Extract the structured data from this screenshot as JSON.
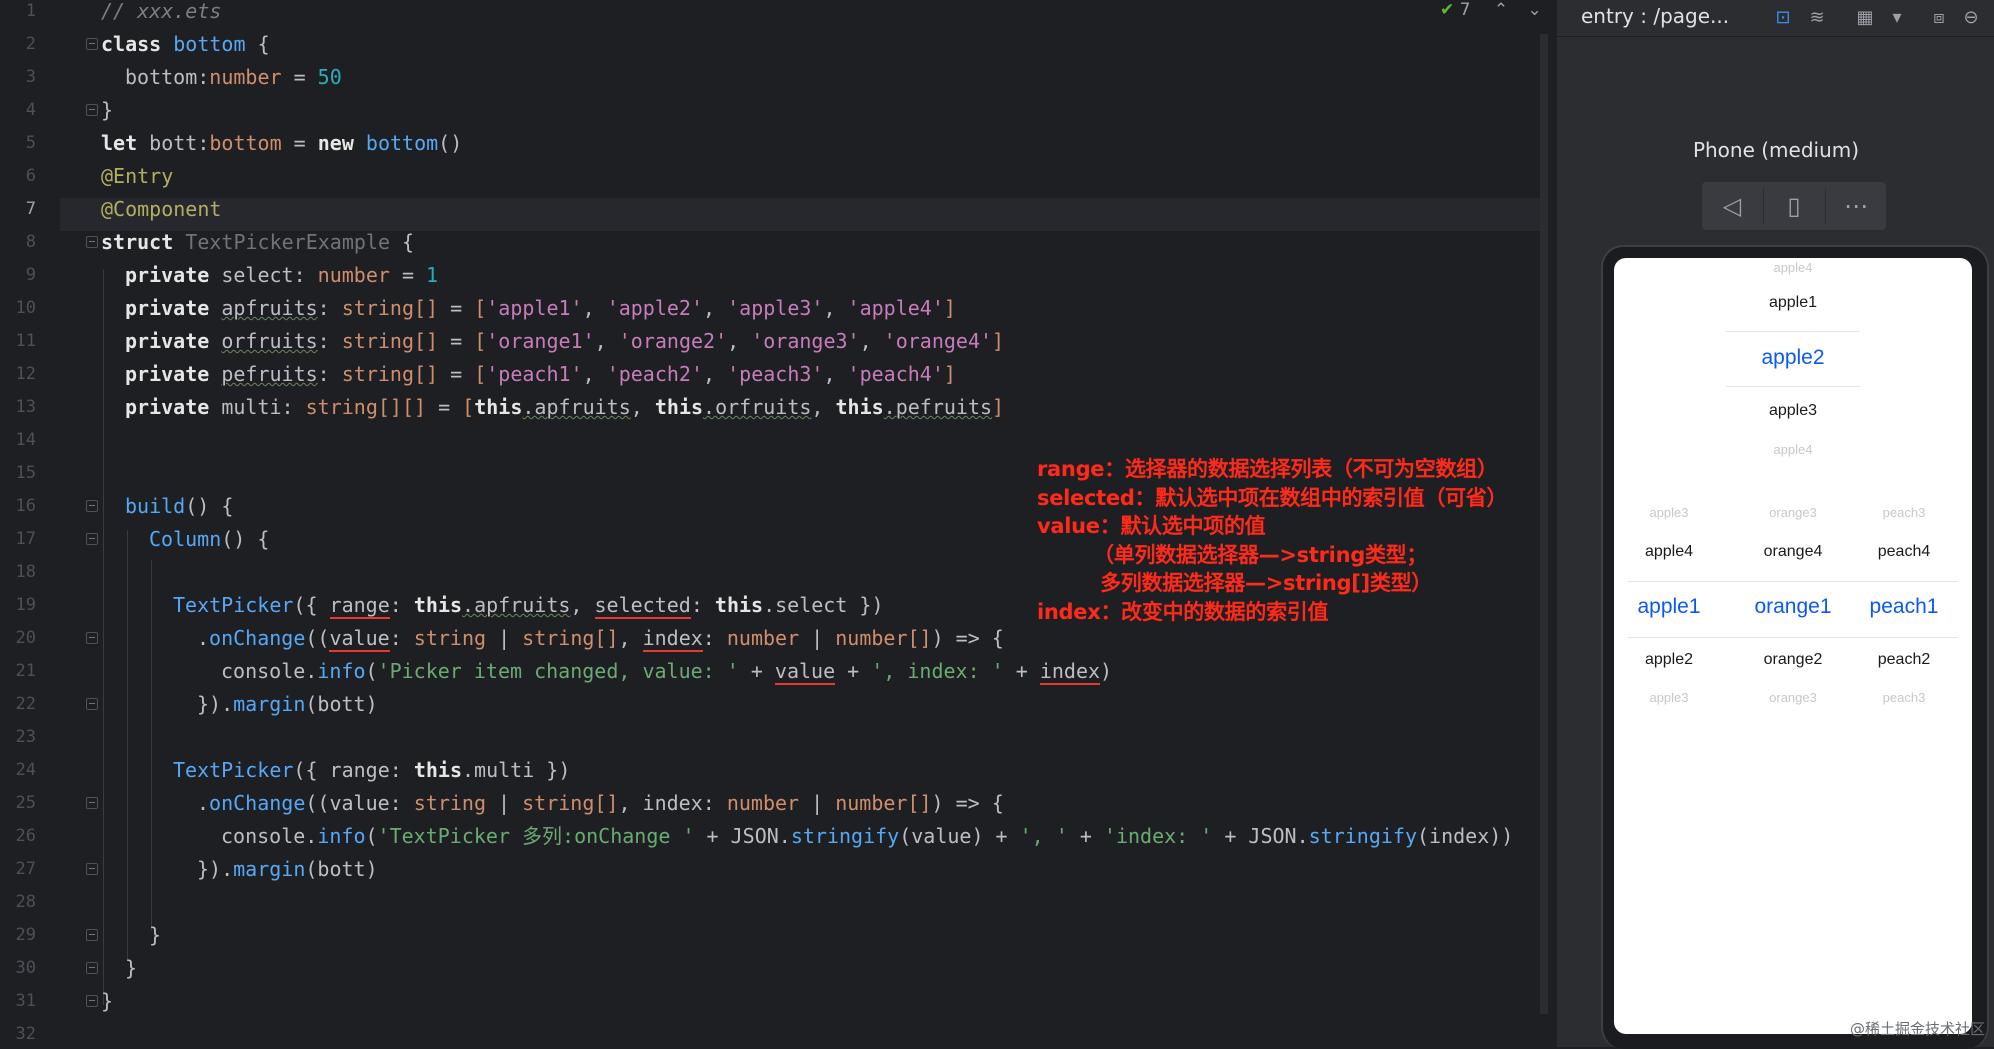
{
  "editor": {
    "inspection_count": "7",
    "lines": [
      {
        "n": "1"
      },
      {
        "n": "2"
      },
      {
        "n": "3"
      },
      {
        "n": "4"
      },
      {
        "n": "5"
      },
      {
        "n": "6"
      },
      {
        "n": "7"
      },
      {
        "n": "8"
      },
      {
        "n": "9"
      },
      {
        "n": "10"
      },
      {
        "n": "11"
      },
      {
        "n": "12"
      },
      {
        "n": "13"
      },
      {
        "n": "14"
      },
      {
        "n": "15"
      },
      {
        "n": "16"
      },
      {
        "n": "17"
      },
      {
        "n": "18"
      },
      {
        "n": "19"
      },
      {
        "n": "20"
      },
      {
        "n": "21"
      },
      {
        "n": "22"
      },
      {
        "n": "23"
      },
      {
        "n": "24"
      },
      {
        "n": "25"
      },
      {
        "n": "26"
      },
      {
        "n": "27"
      },
      {
        "n": "28"
      },
      {
        "n": "29"
      },
      {
        "n": "30"
      },
      {
        "n": "31"
      },
      {
        "n": "32"
      }
    ],
    "code": {
      "l1": "// xxx.ets",
      "l2a": "class",
      "l2b": "bottom",
      "l2c": "{",
      "l3a": "bottom:",
      "l3b": "number",
      "l3c": " = ",
      "l3d": "50",
      "l4": "}",
      "l5a": "let",
      "l5b": " bott:",
      "l5c": "bottom",
      "l5d": " = ",
      "l5e": "new",
      "l5f": "bottom",
      "l5g": "()",
      "l6": "@Entry",
      "l7": "@Component",
      "l8a": "struct",
      "l8b": "TextPickerExample",
      "l8c": "{",
      "l9a": "private",
      "l9b": " select: ",
      "l9c": "number",
      "l9d": " = ",
      "l9e": "1",
      "l10a": "private",
      "l10b": "apfruits",
      "l10c": ": ",
      "l10d": "string[]",
      "l10e": " = ",
      "l10f": "[",
      "l10g": "'apple1'",
      "l10h": "'apple2'",
      "l10i": "'apple3'",
      "l10j": "'apple4'",
      "l10k": "]",
      "l11a": "private",
      "l11b": "orfruits",
      "l11c": ": ",
      "l11d": "string[]",
      "l11e": " = ",
      "l11f": "[",
      "l11g": "'orange1'",
      "l11h": "'orange2'",
      "l11i": "'orange3'",
      "l11j": "'orange4'",
      "l11k": "]",
      "l12a": "private",
      "l12b": "pefruits",
      "l12c": ": ",
      "l12d": "string[]",
      "l12e": " = ",
      "l12f": "[",
      "l12g": "'peach1'",
      "l12h": "'peach2'",
      "l12i": "'peach3'",
      "l12j": "'peach4'",
      "l12k": "]",
      "l13a": "private",
      "l13b": " multi: ",
      "l13c": "string[][]",
      "l13d": " = ",
      "l13e": "[",
      "l13f": "this",
      "l13g": ".apfruits",
      "l13h": "this",
      "l13i": ".orfruits",
      "l13j": "this",
      "l13k": ".pefruits",
      "l13l": "]",
      "l16a": "build",
      "l16b": "() {",
      "l17a": "Column",
      "l17b": "() {",
      "l19a": "TextPicker",
      "l19b": "({ ",
      "l19c": "range",
      "l19d": ": ",
      "l19e": "this",
      "l19f": ".apfruits",
      "l19g": ", ",
      "l19h": "selected",
      "l19i": ": ",
      "l19j": "this",
      "l19k": ".select })",
      "l20a": ".",
      "l20b": "onChange",
      "l20c": "((",
      "l20d": "value",
      "l20e": ": ",
      "l20f": "string",
      "l20g": " | ",
      "l20h": "string[]",
      "l20i": ", ",
      "l20j": "index",
      "l20k": ": ",
      "l20l": "number",
      "l20m": " | ",
      "l20n": "number[]",
      "l20o": ") => {",
      "l21a": "console.",
      "l21b": "info",
      "l21c": "(",
      "l21d": "'Picker item changed, value: '",
      "l21e": " + ",
      "l21f": "value",
      "l21g": " + ",
      "l21h": "', index: '",
      "l21i": " + ",
      "l21j": "index",
      "l21k": ")",
      "l22a": "}).",
      "l22b": "margin",
      "l22c": "(bott)",
      "l24a": "TextPicker",
      "l24b": "({ range: ",
      "l24c": "this",
      "l24d": ".multi })",
      "l25a": ".",
      "l25b": "onChange",
      "l25c": "((value: ",
      "l25d": "string",
      "l25e": " | ",
      "l25f": "string[]",
      "l25g": ", index: ",
      "l25h": "number",
      "l25i": " | ",
      "l25j": "number[]",
      "l25k": ") => {",
      "l26a": "console.",
      "l26b": "info",
      "l26c": "(",
      "l26d": "'TextPicker 多列:onChange '",
      "l26e": " + JSON.",
      "l26f": "stringify",
      "l26g": "(value) + ",
      "l26h": "', '",
      "l26i": " + ",
      "l26j": "'index: '",
      "l26k": " + JSON.",
      "l26l": "stringify",
      "l26m": "(index))",
      "l27a": "}).",
      "l27b": "margin",
      "l27c": "(bott)",
      "l29": "}",
      "l30": "}",
      "l31": "}"
    }
  },
  "annotation": {
    "lines": [
      "range：选择器的数据选择列表（不可为空数组）",
      "selected：默认选中项在数组中的索引值（可省）",
      "value：默认选中项的值",
      "        （单列数据选择器—>string类型；",
      "         多列数据选择器—>string[]类型）",
      "index：改变中的数据的索引值"
    ]
  },
  "preview": {
    "title": "entry : /page...",
    "device_name": "Phone (medium)",
    "single_picker": {
      "top_faded": "apple4",
      "above": "apple1",
      "selected": "apple2",
      "below": "apple3",
      "bottom_faded": "apple4"
    },
    "multi_picker": {
      "columns": [
        {
          "top_faded": "apple3",
          "above": "apple4",
          "selected": "apple1",
          "below": "apple2",
          "bottom_faded": "apple3"
        },
        {
          "top_faded": "orange3",
          "above": "orange4",
          "selected": "orange1",
          "below": "orange2",
          "bottom_faded": "orange3"
        },
        {
          "top_faded": "peach3",
          "above": "peach4",
          "selected": "peach1",
          "below": "peach2",
          "bottom_faded": "peach3"
        }
      ]
    },
    "watermark": "@稀土掘金技术社区"
  },
  "colors": {
    "selected_text": "#0a59f7",
    "annotation": "#ff2a1a"
  },
  "icons": {
    "inspection": "check-icon",
    "prev": "chevron-up-icon",
    "next": "chevron-down-icon",
    "back": "triangle-left-icon",
    "rotate": "rotate-device-icon",
    "more": "more-icon"
  }
}
